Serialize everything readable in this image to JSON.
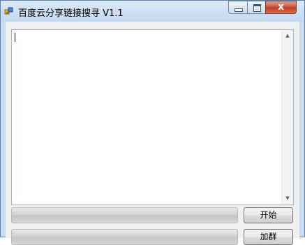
{
  "window": {
    "title": "百度云分享链接搜寻 V1.1"
  },
  "caption_buttons": {
    "close_glyph": "x"
  },
  "icons": {
    "app": "app-icon",
    "minimize": "minimize-icon",
    "maximize": "maximize-icon",
    "close": "close-icon",
    "scroll_up": "arrow-up-icon",
    "scroll_down": "arrow-down-icon"
  },
  "arrows": {
    "up": "▲",
    "down": "▼"
  },
  "buttons": {
    "start_label": "开始",
    "join_label": "加群"
  },
  "colors": {
    "title_bar": "#c9dcf0",
    "close_button": "#c43a22",
    "client_bg": "#f0f0f0"
  }
}
